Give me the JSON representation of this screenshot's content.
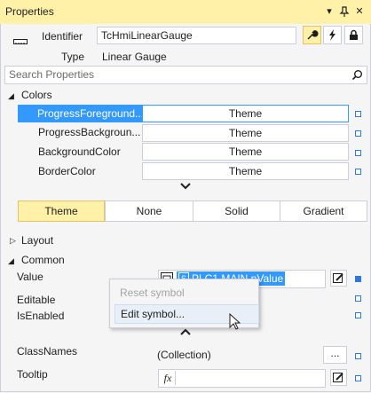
{
  "window": {
    "title": "Properties",
    "dropdown_icon": "chevron-down-icon",
    "pin_icon": "pin-icon",
    "close_icon": "close-icon"
  },
  "header": {
    "identifier_label": "Identifier",
    "identifier_value": "TcHmiLinearGauge",
    "type_label": "Type",
    "type_value": "Linear Gauge",
    "tools": [
      "wrench-icon",
      "lightning-icon",
      "lock-icon"
    ]
  },
  "search": {
    "placeholder": "Search Properties"
  },
  "colors_section": {
    "label": "Colors",
    "rows": [
      {
        "name": "ProgressForeground...",
        "value": "Theme",
        "selected": true
      },
      {
        "name": "ProgressBackgroun...",
        "value": "Theme",
        "selected": false
      },
      {
        "name": "BackgroundColor",
        "value": "Theme",
        "selected": false
      },
      {
        "name": "BorderColor",
        "value": "Theme",
        "selected": false
      }
    ],
    "segments": [
      {
        "label": "Theme",
        "active": true
      },
      {
        "label": "None",
        "active": false
      },
      {
        "label": "Solid",
        "active": false
      },
      {
        "label": "Gradient",
        "active": false
      }
    ]
  },
  "layout_section": {
    "label": "Layout"
  },
  "common_section": {
    "label": "Common",
    "value_label": "Value",
    "value_symbol": "PLC1.MAIN.nValue",
    "editable_label": "Editable",
    "isenabled_label": "IsEnabled",
    "classnames_label": "ClassNames",
    "classnames_value": "(Collection)",
    "classnames_button": "...",
    "tooltip_label": "Tooltip",
    "fx_label": "fx"
  },
  "context_menu": {
    "items": [
      {
        "label": "Reset symbol",
        "enabled": false
      },
      {
        "label": "Edit symbol...",
        "enabled": true,
        "hovered": true
      }
    ]
  },
  "colors": {
    "accent": "#3399ff",
    "title_bg": "#fff1a8"
  }
}
